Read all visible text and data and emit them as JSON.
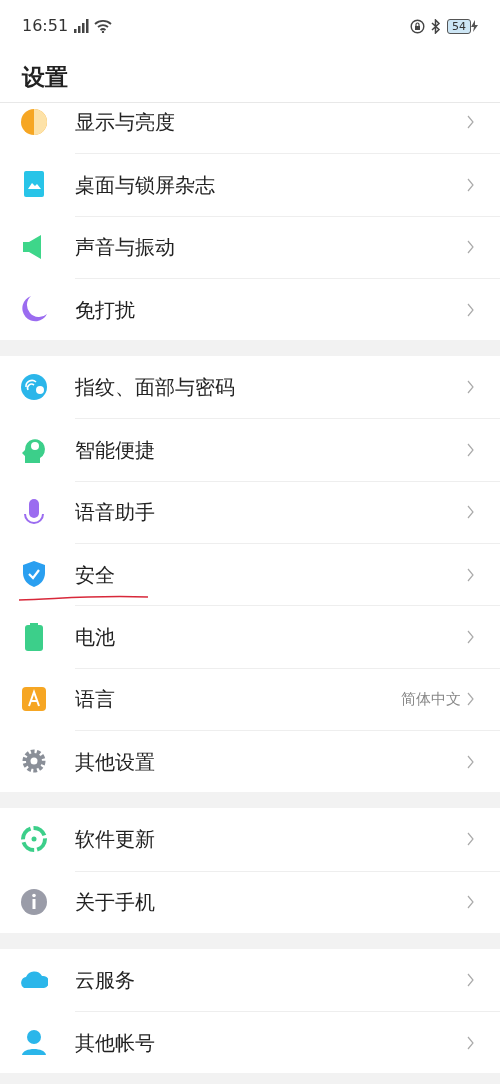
{
  "status_bar": {
    "time": "16:51",
    "battery": "54"
  },
  "header": {
    "title": "设置"
  },
  "groups": [
    {
      "items": [
        {
          "label": "显示与亮度"
        },
        {
          "label": "桌面与锁屏杂志"
        },
        {
          "label": "声音与振动"
        },
        {
          "label": "免打扰"
        }
      ]
    },
    {
      "items": [
        {
          "label": "指纹、面部与密码"
        },
        {
          "label": "智能便捷"
        },
        {
          "label": "语音助手"
        },
        {
          "label": "安全",
          "underlined": true
        },
        {
          "label": "电池"
        },
        {
          "label": "语言",
          "value": "简体中文"
        },
        {
          "label": "其他设置"
        }
      ]
    },
    {
      "items": [
        {
          "label": "软件更新"
        },
        {
          "label": "关于手机"
        }
      ]
    },
    {
      "items": [
        {
          "label": "云服务"
        },
        {
          "label": "其他帐号"
        }
      ]
    }
  ]
}
